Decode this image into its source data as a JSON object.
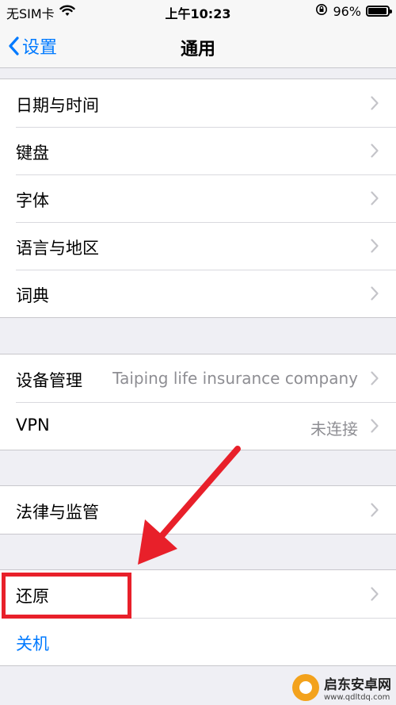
{
  "status_bar": {
    "carrier": "无SIM卡",
    "time": "上午10:23",
    "battery_percent": "96%",
    "battery_level": 0.96,
    "icons": [
      "wifi-icon",
      "orientation-lock-icon",
      "battery-icon"
    ]
  },
  "nav": {
    "back_label": "设置",
    "title": "通用"
  },
  "group1": {
    "items": [
      {
        "label": "日期与时间"
      },
      {
        "label": "键盘"
      },
      {
        "label": "字体"
      },
      {
        "label": "语言与地区"
      },
      {
        "label": "词典"
      }
    ]
  },
  "group2": {
    "items": [
      {
        "label": "设备管理",
        "value": "Taiping life insurance company"
      },
      {
        "label": "VPN",
        "value": "未连接"
      }
    ]
  },
  "group3": {
    "items": [
      {
        "label": "法律与监管"
      }
    ]
  },
  "group4": {
    "items": [
      {
        "label": "还原"
      },
      {
        "label": "关机"
      }
    ]
  },
  "watermark": {
    "title": "启东安卓网",
    "url": "www.qdltdq.com"
  },
  "colors": {
    "accent": "#007aff",
    "annotation": "#e8202a",
    "background": "#efeff4"
  }
}
